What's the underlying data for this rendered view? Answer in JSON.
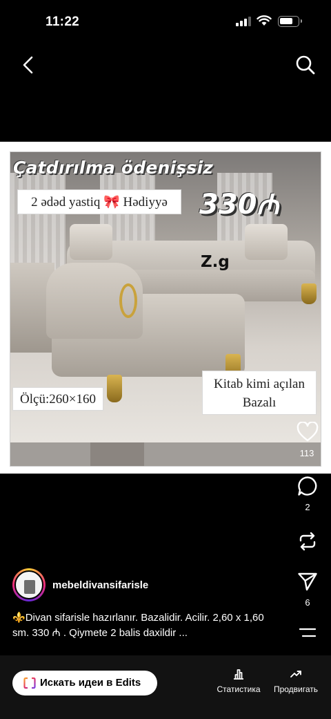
{
  "status_bar": {
    "time": "11:22"
  },
  "post": {
    "image": {
      "banner_top": "Çatdırılma ödenişsiz",
      "gift_text": "2 ədəd yastiq",
      "gift_emoji": "🎀",
      "gift_suffix": "Hədiyyə",
      "price": "330₼",
      "brand_mark": "Z.g",
      "size_label": "Ölçü:260×160",
      "open_line1": "Kitab kimi açılan",
      "open_line2": "Bazalı"
    },
    "likes": "113",
    "comments": "2",
    "shares": "6",
    "username": "mebeldivansifarisle",
    "caption_emoji": "⚜️",
    "caption": "Divan sifarisle hazırlanır. Bazalidir. Acilir.  2,60 x 1,60 sm. 330 ₼ . Qiymete 2 balis daxildir ..."
  },
  "bottom_bar": {
    "edits_button": "Искать идеи в Edits",
    "stats_label": "Статистика",
    "promote_label": "Продвигать"
  },
  "colors": {
    "background": "#000000",
    "bottom_bar": "#121212",
    "gold": "#c9a23c"
  }
}
